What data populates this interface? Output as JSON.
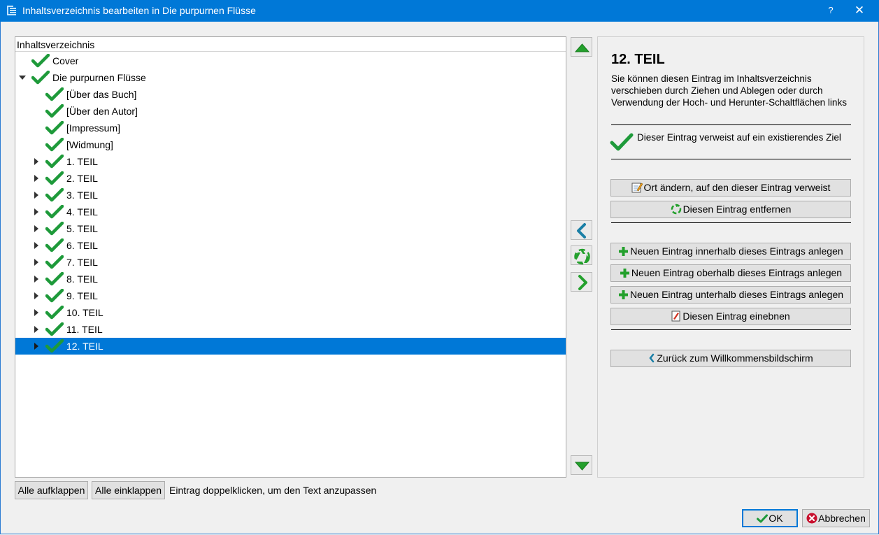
{
  "window": {
    "title": "Inhaltsverzeichnis bearbeiten in Die purpurnen Flüsse",
    "help_label": "?",
    "close_label": "✕"
  },
  "tree": {
    "header": "Inhaltsverzeichnis",
    "items": [
      {
        "label": "Cover",
        "expander": "none"
      },
      {
        "label": "Die purpurnen Flüsse",
        "expander": "expanded"
      },
      {
        "label": "[Über das Buch]",
        "expander": "none"
      },
      {
        "label": "[Über den Autor]",
        "expander": "none"
      },
      {
        "label": "[Impressum]",
        "expander": "none"
      },
      {
        "label": "[Widmung]",
        "expander": "none"
      },
      {
        "label": "1. TEIL",
        "expander": "collapsed"
      },
      {
        "label": "2. TEIL",
        "expander": "collapsed"
      },
      {
        "label": "3. TEIL",
        "expander": "collapsed"
      },
      {
        "label": "4. TEIL",
        "expander": "collapsed"
      },
      {
        "label": "5. TEIL",
        "expander": "collapsed"
      },
      {
        "label": "6. TEIL",
        "expander": "collapsed"
      },
      {
        "label": "7. TEIL",
        "expander": "collapsed"
      },
      {
        "label": "8. TEIL",
        "expander": "collapsed"
      },
      {
        "label": "9. TEIL",
        "expander": "collapsed"
      },
      {
        "label": "10. TEIL",
        "expander": "collapsed"
      },
      {
        "label": "11. TEIL",
        "expander": "collapsed"
      },
      {
        "label": "12. TEIL",
        "expander": "collapsed",
        "selected": true
      }
    ]
  },
  "side_buttons": [
    "move-up",
    "move-left",
    "remove",
    "move-right",
    "move-down"
  ],
  "details": {
    "title": "12. TEIL",
    "description": "Sie können diesen Eintrag im Inhaltsverzeichnis verschieben durch Ziehen und Ablegen oder durch Verwendung der Hoch- und Herunter-Schaltflächen links",
    "status": "Dieser Eintrag verweist auf ein existierendes Ziel",
    "buttons": {
      "change_location": "Ort ändern, auf den dieser Eintrag verweist",
      "remove": "Diesen Eintrag entfernen",
      "add_inside": "Neuen Eintrag innerhalb dieses Eintrags anlegen",
      "add_above": "Neuen Eintrag oberhalb dieses Eintrags anlegen",
      "add_below": "Neuen Eintrag unterhalb dieses Eintrags anlegen",
      "flatten": "Diesen Eintrag einebnen",
      "back": "Zurück zum Willkommensbildschirm"
    }
  },
  "footer": {
    "expand_all": "Alle aufklappen",
    "collapse_all": "Alle einklappen",
    "hint": "Eintrag doppelklicken, um den Text anzupassen"
  },
  "dialog": {
    "ok": "OK",
    "cancel": "Abbrechen"
  },
  "colors": {
    "titlebar": "#0078d7",
    "selection": "#0078d7",
    "check_green": "#1e9a3a",
    "arrow_green": "#23a02c",
    "arrow_teal": "#1a7fa6",
    "cancel_red": "#c8102e"
  }
}
